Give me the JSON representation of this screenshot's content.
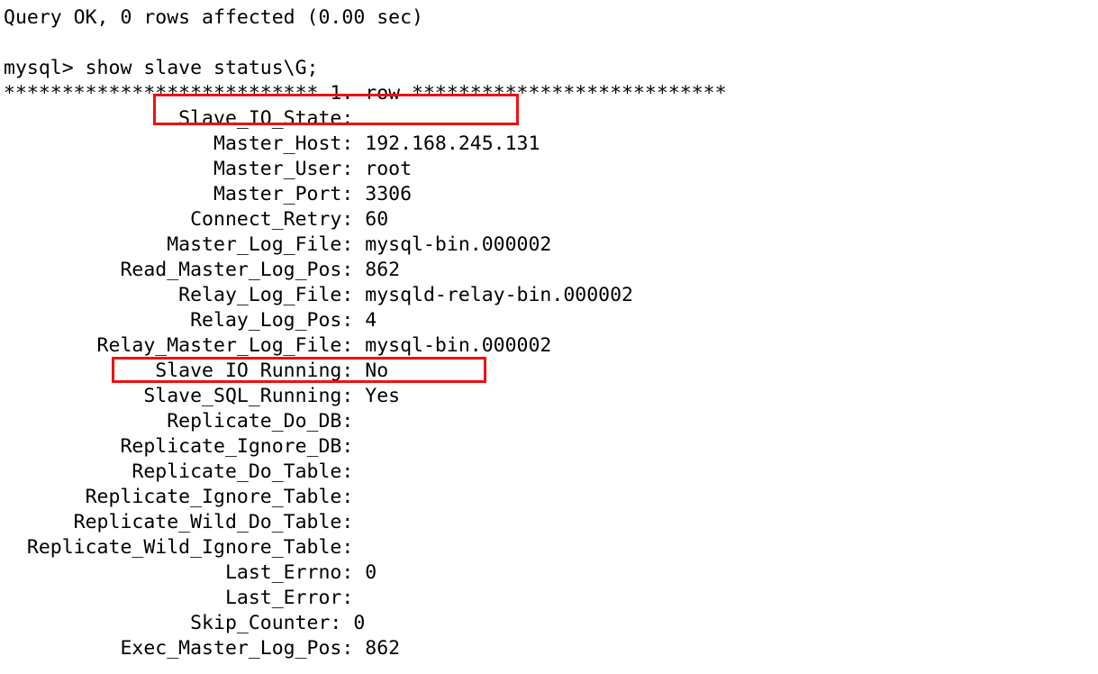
{
  "terminal": {
    "lines": [
      "Query OK, 0 rows affected (0.00 sec)",
      "",
      "mysql> show slave status\\G;",
      "*************************** 1. row ***************************",
      "               Slave_IO_State: ",
      "                  Master_Host: 192.168.245.131",
      "                  Master_User: root",
      "                  Master_Port: 3306",
      "                Connect_Retry: 60",
      "              Master_Log_File: mysql-bin.000002",
      "          Read_Master_Log_Pos: 862",
      "               Relay_Log_File: mysqld-relay-bin.000002",
      "                Relay_Log_Pos: 4",
      "        Relay_Master_Log_File: mysql-bin.000002",
      "             Slave_IO_Running: No",
      "            Slave_SQL_Running: Yes",
      "              Replicate_Do_DB: ",
      "          Replicate_Ignore_DB: ",
      "           Replicate_Do_Table: ",
      "       Replicate_Ignore_Table: ",
      "      Replicate_Wild_Do_Table: ",
      "  Replicate_Wild_Ignore_Table: ",
      "                   Last_Errno: 0",
      "                   Last_Error: ",
      "                Skip_Counter: 0",
      "          Exec_Master_Log_Pos: 862"
    ],
    "fields": {
      "prompt": "mysql>",
      "command": "show slave status\\G;",
      "result_status": "Query OK, 0 rows affected (0.00 sec)",
      "row_separator": "*************************** 1. row ***************************",
      "Slave_IO_State": "",
      "Master_Host": "192.168.245.131",
      "Master_User": "root",
      "Master_Port": "3306",
      "Connect_Retry": "60",
      "Master_Log_File": "mysql-bin.000002",
      "Read_Master_Log_Pos": "862",
      "Relay_Log_File": "mysqld-relay-bin.000002",
      "Relay_Log_Pos": "4",
      "Relay_Master_Log_File": "mysql-bin.000002",
      "Slave_IO_Running": "No",
      "Slave_SQL_Running": "Yes",
      "Replicate_Do_DB": "",
      "Replicate_Ignore_DB": "",
      "Replicate_Do_Table": "",
      "Replicate_Ignore_Table": "",
      "Replicate_Wild_Do_Table": "",
      "Replicate_Wild_Ignore_Table": "",
      "Last_Errno": "0",
      "Last_Error": "",
      "Skip_Counter": "0",
      "Exec_Master_Log_Pos": "862"
    }
  },
  "annotations": {
    "highlight_color": "#ee1111",
    "boxes": [
      {
        "label": "Slave_IO_State",
        "target_line": 4
      },
      {
        "label": "Slave_IO_Running",
        "target_line": 14
      }
    ]
  },
  "colors": {
    "background": "#ffffff",
    "text": "#000000",
    "annotation": "#ee1111"
  }
}
